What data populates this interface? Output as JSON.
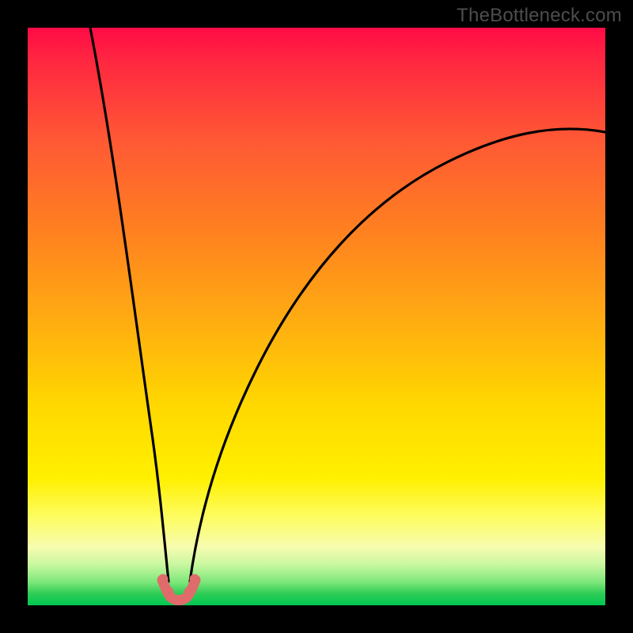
{
  "watermark": {
    "text": "TheBottleneck.com"
  },
  "chart_data": {
    "type": "line",
    "title": "",
    "xlabel": "",
    "ylabel": "",
    "xlim": [
      0,
      100
    ],
    "ylim": [
      0,
      100
    ],
    "grid": false,
    "series": [
      {
        "name": "left-branch",
        "color": "#000000",
        "x": [
          11,
          12,
          13,
          14,
          15,
          16,
          17,
          18,
          19,
          20,
          21,
          22,
          23,
          24
        ],
        "y": [
          100,
          88,
          76,
          65,
          55,
          46,
          38,
          30,
          23,
          17,
          12,
          8,
          4,
          1.5
        ]
      },
      {
        "name": "right-branch",
        "color": "#000000",
        "x": [
          28,
          30,
          33,
          36,
          40,
          45,
          50,
          55,
          60,
          66,
          72,
          78,
          85,
          92,
          100
        ],
        "y": [
          1.5,
          5,
          11,
          18,
          26,
          35,
          43,
          50,
          56,
          62,
          67,
          71,
          75,
          79,
          82
        ]
      },
      {
        "name": "bottom-highlight",
        "color": "#e06b6b",
        "x": [
          23.5,
          24.2,
          25,
          26,
          27,
          27.8,
          28.5
        ],
        "y": [
          3.5,
          1.7,
          0.9,
          0.7,
          0.9,
          1.7,
          3.5
        ]
      }
    ],
    "notch_x_range": [
      23.5,
      28.5
    ],
    "background_gradient": {
      "top": "#ff0b46",
      "middle": "#ffd700",
      "bottom": "#00c853"
    }
  }
}
